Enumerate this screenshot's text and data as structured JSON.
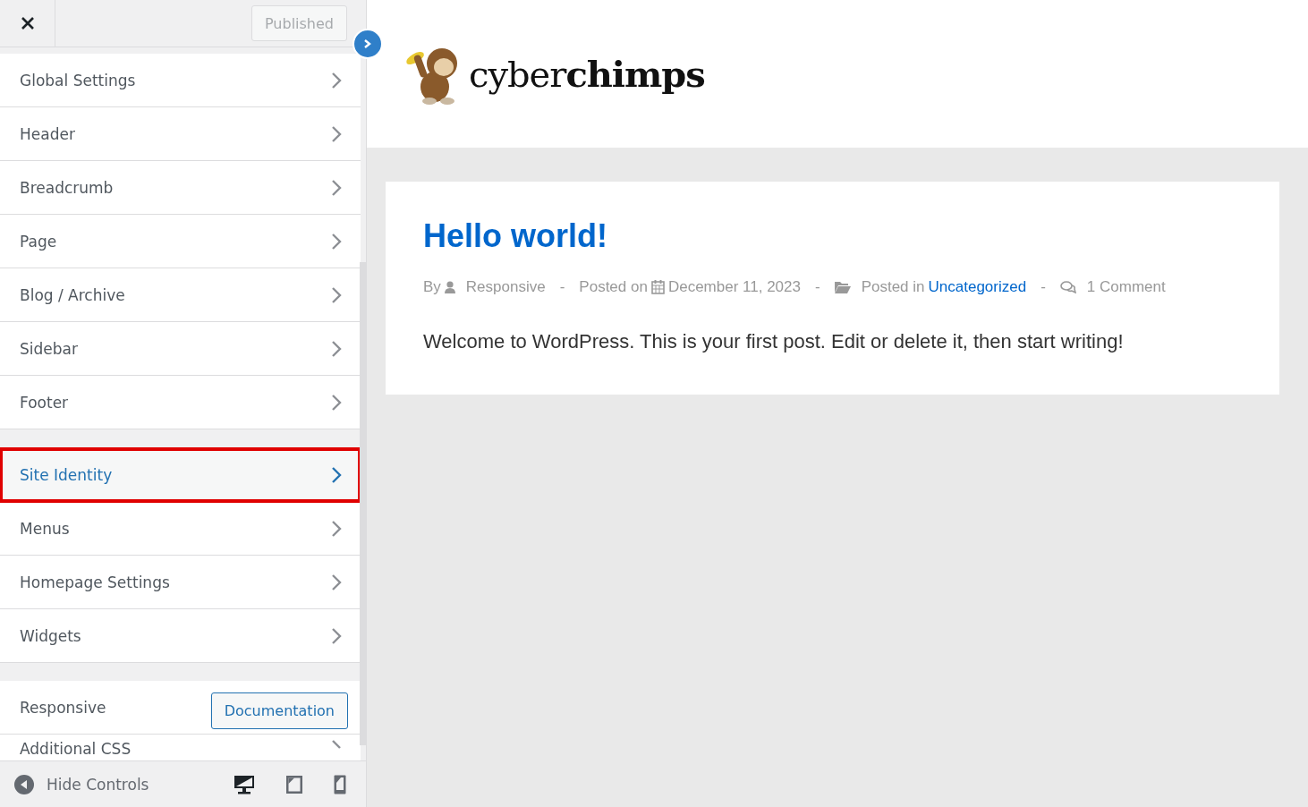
{
  "top_bar": {
    "publish_button": "Published"
  },
  "sections": [
    {
      "items": [
        {
          "label": "Global Settings",
          "selected": false,
          "outlined": false
        },
        {
          "label": "Header",
          "selected": false,
          "outlined": false
        },
        {
          "label": "Breadcrumb",
          "selected": false,
          "outlined": false
        },
        {
          "label": "Page",
          "selected": false,
          "outlined": false
        },
        {
          "label": "Blog / Archive",
          "selected": false,
          "outlined": false
        },
        {
          "label": "Sidebar",
          "selected": false,
          "outlined": false
        },
        {
          "label": "Footer",
          "selected": false,
          "outlined": false
        }
      ]
    },
    {
      "items": [
        {
          "label": "Site Identity",
          "selected": true,
          "outlined": true
        },
        {
          "label": "Menus",
          "selected": false,
          "outlined": false
        },
        {
          "label": "Homepage Settings",
          "selected": false,
          "outlined": false
        },
        {
          "label": "Widgets",
          "selected": false,
          "outlined": false
        }
      ]
    }
  ],
  "theme_row": {
    "label": "Responsive",
    "button": "Documentation"
  },
  "last_item": {
    "label": "Additional CSS"
  },
  "footer": {
    "hide_label": "Hide Controls",
    "devices": [
      {
        "kind": "desktop",
        "selected": true
      },
      {
        "kind": "tablet",
        "selected": false
      },
      {
        "kind": "mobile",
        "selected": false
      }
    ]
  },
  "preview": {
    "logo": "cyber**chimps**",
    "post": {
      "title": "Hello world!",
      "by": "By",
      "author": "Responsive",
      "sep1": "-",
      "posted_on": "Posted on",
      "date": "December 11, 2023",
      "sep2": "-",
      "posted_in": "Posted in",
      "category": "Uncategorized",
      "sep3": "-",
      "comments": "1 Comment",
      "body": "Welcome to WordPress. This is your first post. Edit or delete it, then start writing!"
    }
  }
}
